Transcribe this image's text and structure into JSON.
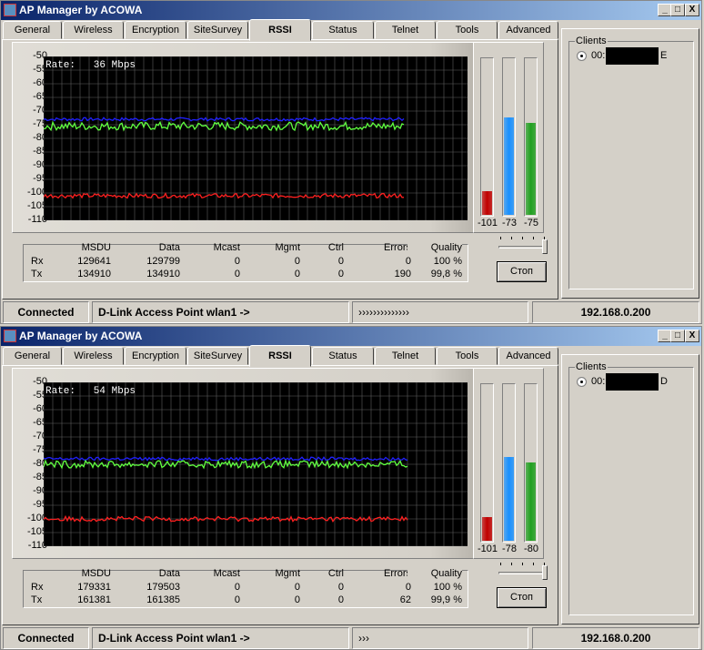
{
  "windows": [
    {
      "title": "AP Manager by ACOWA",
      "title_buttons": [
        "_",
        "□",
        "X"
      ],
      "tabs": [
        "General",
        "Wireless",
        "Encryption",
        "SiteSurvey",
        "RSSI",
        "Status",
        "Telnet",
        "Tools",
        "Advanced"
      ],
      "active_tab": "RSSI",
      "rate_text": "Rate:   36 Mbps",
      "meters": {
        "values": [
          "-101",
          "-73",
          "-75"
        ]
      },
      "stats": {
        "headers": [
          "MSDU",
          "Data",
          "Mcast",
          "Mgmt",
          "Ctrl",
          "Errors",
          "Quality"
        ],
        "rows": [
          {
            "label": "Rx",
            "cells": [
              "129641",
              "129799",
              "0",
              "0",
              "0",
              "0",
              "100 %"
            ]
          },
          {
            "label": "Tx",
            "cells": [
              "134910",
              "134910",
              "0",
              "0",
              "0",
              "190",
              "99,8 %"
            ]
          }
        ]
      },
      "stop_button": "Стоп",
      "clients": {
        "label": "Clients",
        "items": [
          {
            "prefix": "00:",
            "suffix": "E"
          }
        ]
      },
      "statusbar": {
        "state": "Connected",
        "device": "D-Link Access Point wlan1 ->",
        "progress": "››››››››››››››",
        "ip": "192.168.0.200"
      }
    },
    {
      "title": "AP Manager by ACOWA",
      "title_buttons": [
        "_",
        "□",
        "X"
      ],
      "tabs": [
        "General",
        "Wireless",
        "Encryption",
        "SiteSurvey",
        "RSSI",
        "Status",
        "Telnet",
        "Tools",
        "Advanced"
      ],
      "active_tab": "RSSI",
      "rate_text": "Rate:   54 Mbps",
      "meters": {
        "values": [
          "-101",
          "-78",
          "-80"
        ]
      },
      "stats": {
        "headers": [
          "MSDU",
          "Data",
          "Mcast",
          "Mgmt",
          "Ctrl",
          "Errors",
          "Quality"
        ],
        "rows": [
          {
            "label": "Rx",
            "cells": [
              "179331",
              "179503",
              "0",
              "0",
              "0",
              "0",
              "100 %"
            ]
          },
          {
            "label": "Tx",
            "cells": [
              "161381",
              "161385",
              "0",
              "0",
              "0",
              "62",
              "99,9 %"
            ]
          }
        ]
      },
      "stop_button": "Стоп",
      "clients": {
        "label": "Clients",
        "items": [
          {
            "prefix": "00:",
            "suffix": "D"
          }
        ]
      },
      "statusbar": {
        "state": "Connected",
        "device": "D-Link Access Point wlan1 ->",
        "progress": "›››",
        "ip": "192.168.0.200"
      }
    }
  ],
  "chart_data": [
    {
      "type": "line",
      "title": "RSSI",
      "ylim": [
        -110,
        -50
      ],
      "yticks": [
        "-50",
        "-55",
        "-60",
        "-65",
        "-70",
        "-75",
        "-80",
        "-85",
        "-90",
        "-95",
        "-100",
        "-105",
        "-110"
      ],
      "grid": true,
      "series": [
        {
          "name": "blue",
          "color": "#2020ff",
          "mean": -73,
          "jitter": 0.6
        },
        {
          "name": "green",
          "color": "#60ff40",
          "mean": -75.5,
          "jitter": 1.5
        },
        {
          "name": "red",
          "color": "#ff2020",
          "mean": -101,
          "jitter": 0.8
        }
      ],
      "fill_fraction": 0.85
    },
    {
      "type": "line",
      "title": "RSSI",
      "ylim": [
        -110,
        -50
      ],
      "yticks": [
        "-50",
        "-55",
        "-60",
        "-65",
        "-70",
        "-75",
        "-80",
        "-85",
        "-90",
        "-95",
        "-100",
        "-105",
        "-110"
      ],
      "grid": true,
      "series": [
        {
          "name": "blue",
          "color": "#2020ff",
          "mean": -78,
          "jitter": 0.6
        },
        {
          "name": "green",
          "color": "#60ff40",
          "mean": -80,
          "jitter": 1.3
        },
        {
          "name": "red",
          "color": "#ff2020",
          "mean": -100,
          "jitter": 0.9
        }
      ],
      "fill_fraction": 0.86
    }
  ],
  "meter_colors": [
    "#c00000",
    "#1890ff",
    "#20a020"
  ]
}
